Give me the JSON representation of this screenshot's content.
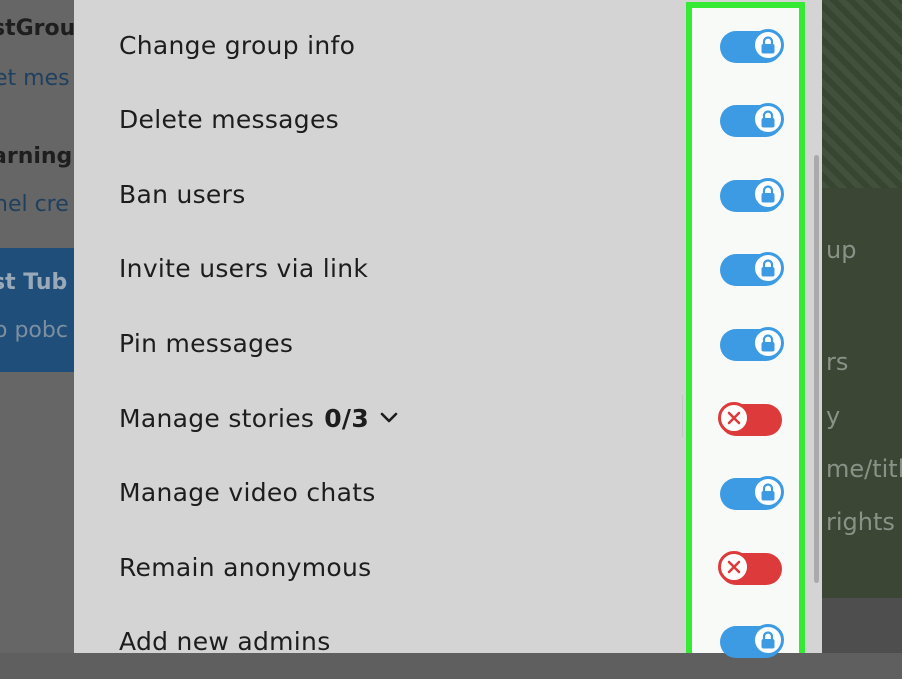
{
  "background_left": [
    {
      "title": "stGrou",
      "subtitle": "et mes"
    },
    {
      "title": "arning",
      "subtitle": "nel cre"
    },
    {
      "title": "st Tub",
      "subtitle": "o pobc",
      "selected": true
    }
  ],
  "background_right": {
    "lines": [
      "up",
      "rs",
      "y",
      "me/titl",
      "rights"
    ]
  },
  "permissions": [
    {
      "label": "Change group info",
      "state": "on",
      "locked": true
    },
    {
      "label": "Delete messages",
      "state": "on",
      "locked": true
    },
    {
      "label": "Ban users",
      "state": "on",
      "locked": true
    },
    {
      "label": "Invite users via link",
      "state": "on",
      "locked": true
    },
    {
      "label": "Pin messages",
      "state": "on",
      "locked": true
    },
    {
      "label": "Manage stories",
      "count": "0/3",
      "expandable": true,
      "state": "off",
      "locked": false
    },
    {
      "label": "Manage video chats",
      "state": "on",
      "locked": true
    },
    {
      "label": "Remain anonymous",
      "state": "off",
      "locked": false
    },
    {
      "label": "Add new admins",
      "state": "on",
      "locked": true
    }
  ],
  "colors": {
    "toggle_on": "#3d9be3",
    "toggle_off": "#dd3b3b",
    "highlight_border": "#35e935",
    "dialog_bg": "#d4d4d4"
  },
  "icons": {
    "locked": "lock-icon",
    "disabled": "close-x-icon",
    "expand": "chevron-down-icon"
  }
}
